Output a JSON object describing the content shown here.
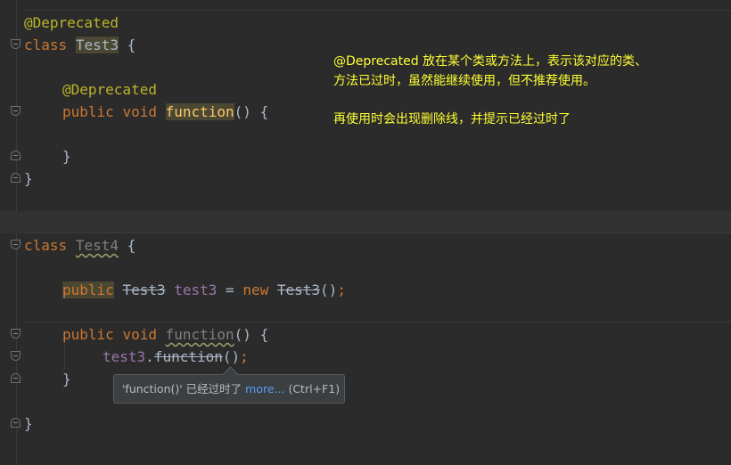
{
  "code": {
    "l1_annotation": "@Deprecated",
    "l2_kw": "class",
    "l2_name": "Test3",
    "l2_brace": " {",
    "l3_annotation": "@Deprecated",
    "l4_kw1": "public",
    "l4_kw2": "void",
    "l4_name": "function",
    "l4_rest": "() {",
    "l5_brace": "}",
    "l6_brace": "}",
    "l7_kw": "class",
    "l7_name": "Test4",
    "l7_brace": " {",
    "l8_kw": "public",
    "l8_type": "Test3",
    "l8_var": "test3",
    "l8_eq": " = ",
    "l8_new": "new",
    "l8_ctor": "Test3",
    "l8_parens": "()",
    "l8_semi": ";",
    "l9_kw1": "public",
    "l9_kw2": "void",
    "l9_name": "function",
    "l9_rest": "() {",
    "l10_var": "test3",
    "l10_dot": ".",
    "l10_call": "function",
    "l10_parens": "()",
    "l10_semi": ";",
    "l11_brace": "}",
    "l12_brace": "}"
  },
  "note": {
    "line1": "@Deprecated 放在某个类或方法上，表示该对应的类、",
    "line2": "方法已过时，虽然能继续使用，但不推荐使用。",
    "line3": "再使用时会出现删除线，并提示已经过时了"
  },
  "tooltip": {
    "message": "'function()' 已经过时了",
    "more_link": "more...",
    "shortcut": "(Ctrl+F1)"
  },
  "colors": {
    "background": "#2b2b2b",
    "keyword": "#cc7832",
    "annotation": "#bbb529",
    "field": "#9876aa",
    "note_text": "#ffff33",
    "link": "#589df6"
  }
}
